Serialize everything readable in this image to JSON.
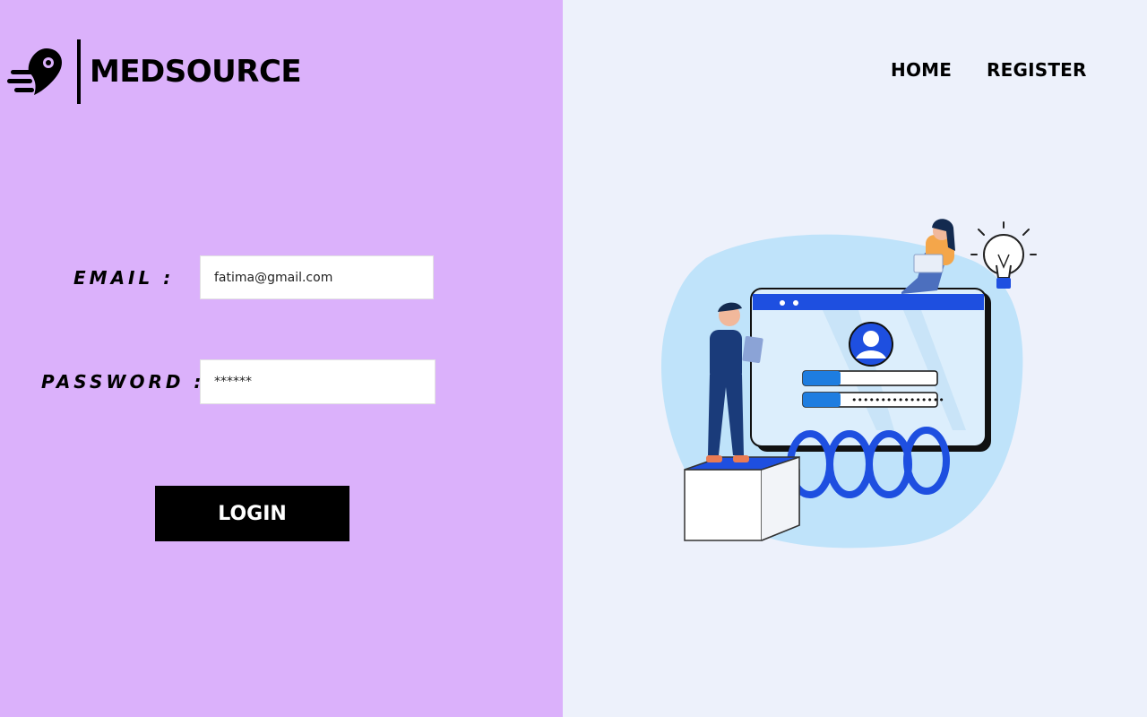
{
  "brand": {
    "name": "MEDSOURCE",
    "logo_icon": "speed-pin-icon"
  },
  "nav": {
    "home": "HOME",
    "register": "REGISTER"
  },
  "form": {
    "email_label": "EMAIL :",
    "email_value": "fatima@gmail.com",
    "password_label": "PASSWORD :",
    "password_value": "******",
    "login_label": "LOGIN"
  },
  "colors": {
    "left_bg": "#dbb1fb",
    "right_bg": "#edf1fb",
    "button_bg": "#000000",
    "accent_blue": "#1e4fe0"
  }
}
